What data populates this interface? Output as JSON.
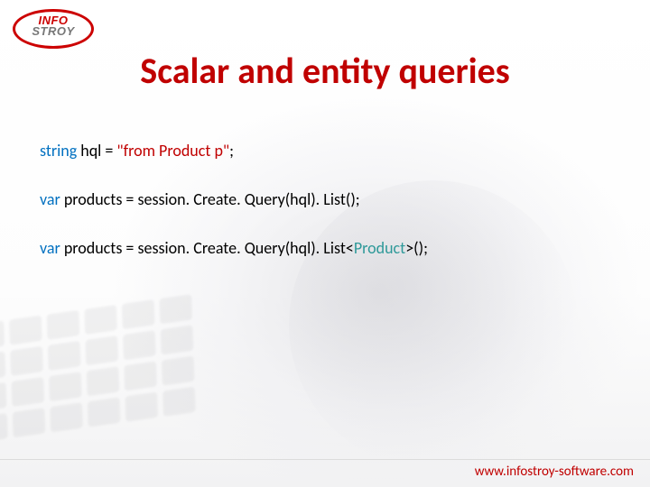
{
  "logo": {
    "line1": "INFO",
    "line2": "STROY"
  },
  "title": "Scalar and entity queries",
  "code": {
    "l1_kw": "string",
    "l1_var": " hql = ",
    "l1_str": "\"from Product p\"",
    "l1_end": ";",
    "l2_kw": "var",
    "l2_rest": " products = session. Create. Query(hql). List();",
    "l3_kw": "var",
    "l3_a": " products = session. Create. Query(hql). List<",
    "l3_type": "Product",
    "l3_b": ">();"
  },
  "footer": {
    "url": "www.infostroy-software.com"
  }
}
